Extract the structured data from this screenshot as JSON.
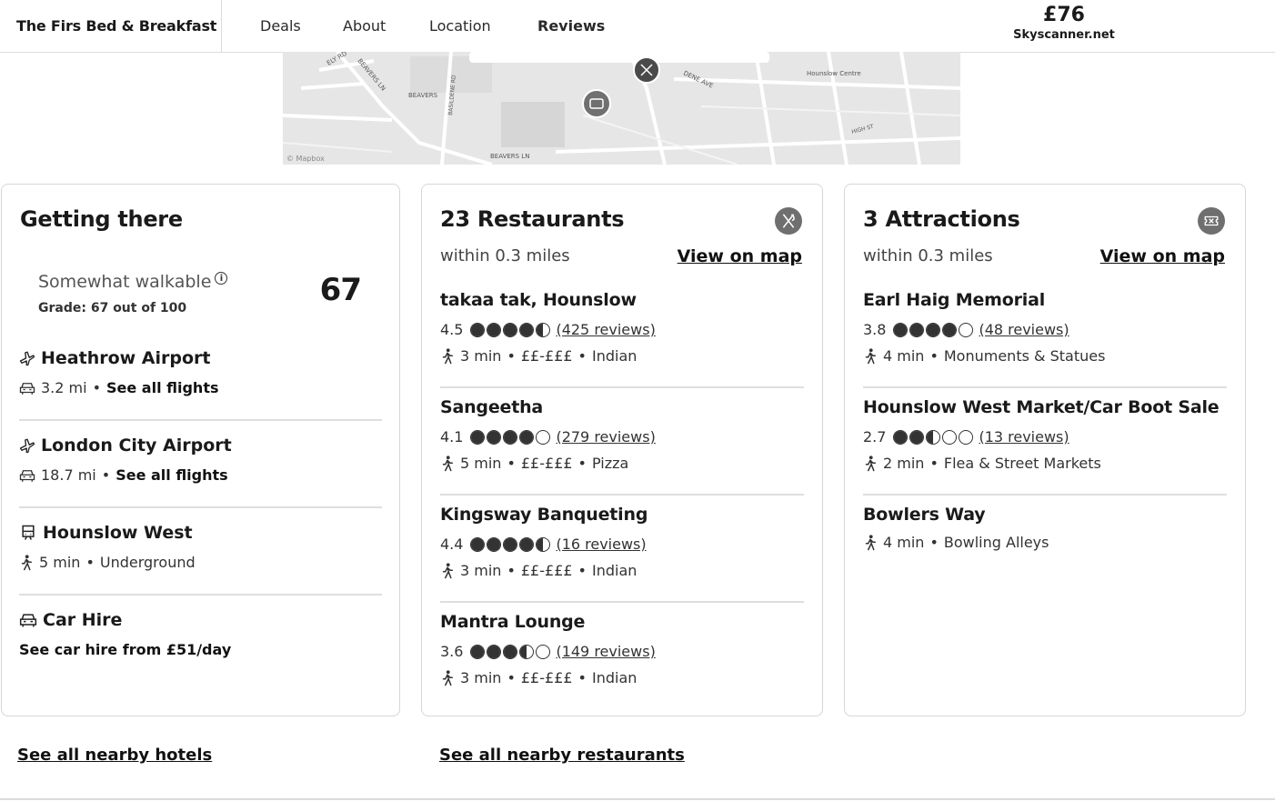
{
  "header": {
    "brand": "The Firs Bed & Breakfast",
    "nav": [
      {
        "label": "Deals",
        "active": false
      },
      {
        "label": "About",
        "active": false
      },
      {
        "label": "Location",
        "active": false
      },
      {
        "label": "Reviews",
        "active": true
      }
    ],
    "price": "£76",
    "price_source": "Skyscanner.net"
  },
  "map": {
    "labels": [
      "ELY RD",
      "BEAVERS",
      "BASILDENE RD",
      "BEAVERS LN",
      "DENE AVE",
      "Hounslow Centre",
      "HIGH ST",
      "© Mapbox"
    ],
    "icons": [
      "hotel-pin-icon",
      "restaurant-pin-icon"
    ]
  },
  "getting_there": {
    "title": "Getting there",
    "walkability": {
      "label": "Somewhat walkable",
      "grade": "Grade: 67 out of 100",
      "score": "67"
    },
    "items": [
      {
        "name": "Heathrow Airport",
        "icon": "plane-icon",
        "meta_icon": "car-icon",
        "distance": "3.2 mi",
        "link": "See all flights"
      },
      {
        "name": "London City Airport",
        "icon": "plane-icon",
        "meta_icon": "car-icon",
        "distance": "18.7 mi",
        "link": "See all flights"
      },
      {
        "name": "Hounslow West",
        "icon": "train-icon",
        "meta_icon": "walk-icon",
        "distance": "5 min",
        "link": "Underground"
      },
      {
        "name": "Car Hire",
        "icon": "car-icon",
        "meta_icon": "",
        "distance": "",
        "link": "See car hire from £51/day"
      }
    ],
    "separator": "•"
  },
  "restaurants": {
    "title": "23 Restaurants",
    "icon": "cutlery-icon",
    "subtitle": "within 0.3 miles",
    "link": "View on map",
    "items": [
      {
        "name": "takaa tak, Hounslow",
        "rating": "4.5",
        "rating_value": 4.5,
        "reviews": "(425 reviews)",
        "time": "3 min",
        "price": "££-£££",
        "category": "Indian"
      },
      {
        "name": "Sangeetha",
        "rating": "4.1",
        "rating_value": 4.0,
        "reviews": "(279 reviews)",
        "time": "5 min",
        "price": "££-£££",
        "category": "Pizza"
      },
      {
        "name": "Kingsway Banqueting",
        "rating": "4.4",
        "rating_value": 4.5,
        "reviews": "(16 reviews)",
        "time": "3 min",
        "price": "££-£££",
        "category": "Indian"
      },
      {
        "name": "Mantra Lounge",
        "rating": "3.6",
        "rating_value": 3.5,
        "reviews": "(149 reviews)",
        "time": "3 min",
        "price": "££-£££",
        "category": "Indian"
      }
    ]
  },
  "attractions": {
    "title": "3 Attractions",
    "icon": "ticket-icon",
    "subtitle": "within 0.3 miles",
    "link": "View on map",
    "items": [
      {
        "name": "Earl Haig Memorial",
        "rating": "3.8",
        "rating_value": 4.0,
        "reviews": "(48 reviews)",
        "time": "4 min",
        "category": "Monuments & Statues"
      },
      {
        "name": "Hounslow West Market/Car Boot Sale",
        "rating": "2.7",
        "rating_value": 2.5,
        "reviews": "(13 reviews)",
        "time": "2 min",
        "category": "Flea & Street Markets"
      },
      {
        "name": "Bowlers Way",
        "rating": "",
        "rating_value": null,
        "reviews": "",
        "time": "4 min",
        "category": "Bowling Alleys"
      }
    ]
  },
  "footer": {
    "hotels_link": "See all nearby hotels",
    "restaurants_link": "See all nearby restaurants"
  }
}
